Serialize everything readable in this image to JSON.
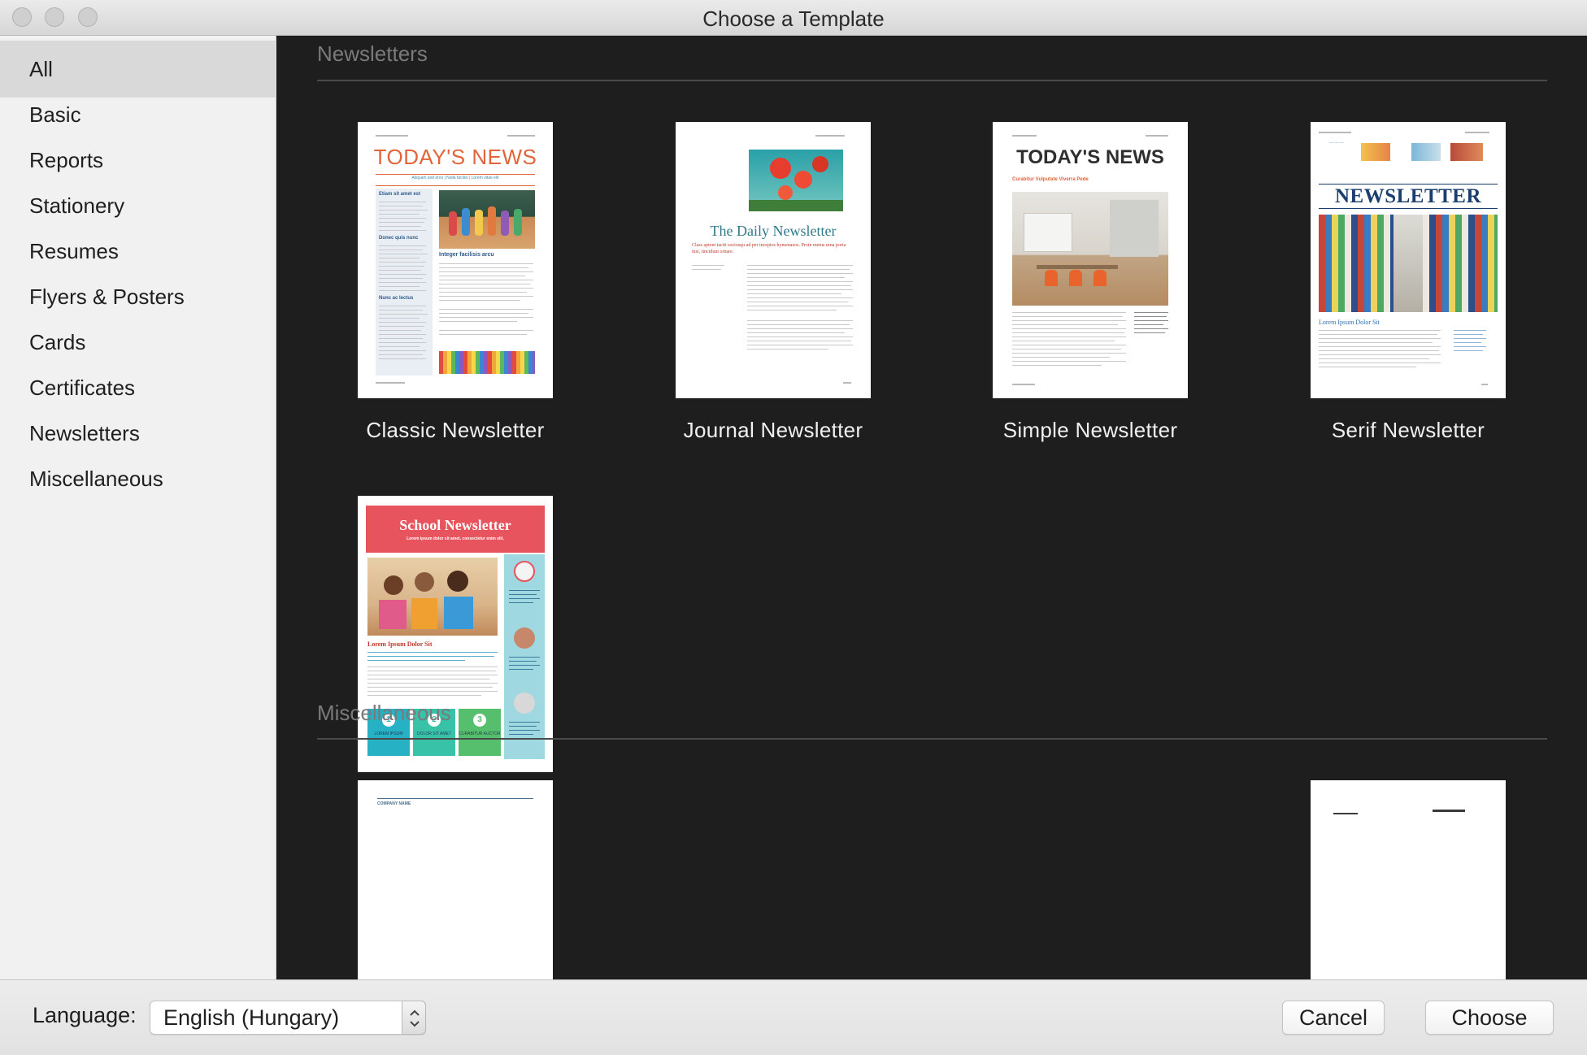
{
  "window": {
    "title": "Choose a Template"
  },
  "sidebar": {
    "items": [
      {
        "label": "All",
        "selected": true
      },
      {
        "label": "Basic"
      },
      {
        "label": "Reports"
      },
      {
        "label": "Stationery"
      },
      {
        "label": "Resumes"
      },
      {
        "label": "Flyers & Posters"
      },
      {
        "label": "Cards"
      },
      {
        "label": "Certificates"
      },
      {
        "label": "Newsletters"
      },
      {
        "label": "Miscellaneous"
      }
    ]
  },
  "sections": {
    "newsletters": {
      "title": "Newsletters",
      "templates": [
        {
          "label": "Classic Newsletter",
          "thumb_headline": "TODAY'S NEWS",
          "thumb_subtitle": "Aliquam sed eros | Nulla facilisi | Lorem vitae elit",
          "thumb_heading1": "Etiam sit amet est",
          "thumb_heading2": "Donec quis nunc",
          "thumb_heading3": "Integer facilisis arcu",
          "thumb_heading4": "Nunc ac lectus"
        },
        {
          "label": "Journal Newsletter",
          "thumb_headline": "The Daily Newsletter",
          "thumb_subtitle": "Class aptent taciti sociosqu ad per inceptos hymenaeos. Proin metus urna porta nisi, tincidunt ornare."
        },
        {
          "label": "Simple Newsletter",
          "thumb_headline": "TODAY'S NEWS",
          "thumb_subtitle": "Curabitur Vulputate Viverra Pede"
        },
        {
          "label": "Serif Newsletter",
          "thumb_headline": "NEWSLETTER",
          "thumb_subtitle": "Lorem Ipsum Dolor Sit"
        },
        {
          "label": "School Newsletter",
          "thumb_headline": "School Newsletter",
          "thumb_subtitle": "Lorem ipsum dolor sit amet, consectetur enim elit.",
          "thumb_heading1": "Lorem Ipsum Dolor Sit",
          "thumb_boxes": [
            "LOREM IPSUM",
            "DOLOR SIT AMET",
            "CURABITUR AUCTOR"
          ],
          "thumb_box_numbers": [
            "1",
            "2",
            "3"
          ]
        }
      ]
    },
    "miscellaneous": {
      "title": "Miscellaneous",
      "templates": [
        {
          "thumb_text": "COMPANY NAME"
        },
        {}
      ]
    }
  },
  "footer": {
    "language_label": "Language:",
    "language_value": "English (Hungary)",
    "cancel_label": "Cancel",
    "choose_label": "Choose"
  },
  "colors": {
    "classic_accent": "#e2643a",
    "journal_accent": "#2f7a8a",
    "simple_accent": "#e2643a",
    "serif_accent": "#1c3e6e",
    "school_accent": "#e8545e",
    "school_panel": "#9fd8e0",
    "school_box1": "#26b1c4",
    "school_box2": "#38c3a9",
    "school_box3": "#56bf6e"
  }
}
